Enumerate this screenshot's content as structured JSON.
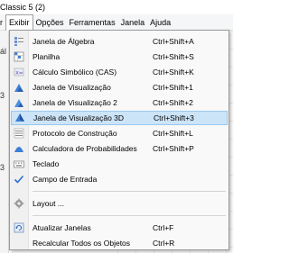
{
  "window": {
    "title": "Classic 5 (2)"
  },
  "menubar": {
    "items": [
      {
        "label": "r",
        "active": false
      },
      {
        "label": "Exibir",
        "active": true
      },
      {
        "label": "Opções",
        "active": false
      },
      {
        "label": "Ferramentas",
        "active": false
      },
      {
        "label": "Janela",
        "active": false
      },
      {
        "label": "Ajuda",
        "active": false
      }
    ]
  },
  "background": {
    "left_labels": [
      "ál",
      "3",
      "3"
    ]
  },
  "menu": {
    "items": [
      {
        "label": "Janela de Álgebra",
        "shortcut": "Ctrl+Shift+A",
        "icon": "algebra-view-icon"
      },
      {
        "label": "Planilha",
        "shortcut": "Ctrl+Shift+S",
        "icon": "spreadsheet-icon"
      },
      {
        "label": "Cálculo Simbólico (CAS)",
        "shortcut": "Ctrl+Shift+K",
        "icon": "cas-icon"
      },
      {
        "label": "Janela de Visualização",
        "shortcut": "Ctrl+Shift+1",
        "icon": "graphics-view-icon"
      },
      {
        "label": "Janela de Visualização 2",
        "shortcut": "Ctrl+Shift+2",
        "icon": "graphics-view-2-icon"
      },
      {
        "label": "Janela de Visualização 3D",
        "shortcut": "Ctrl+Shift+3",
        "icon": "graphics-3d-icon",
        "highlighted": true
      },
      {
        "label": "Protocolo de Construção",
        "shortcut": "Ctrl+Shift+L",
        "icon": "construction-protocol-icon"
      },
      {
        "label": "Calculadora de Probabilidades",
        "shortcut": "Ctrl+Shift+P",
        "icon": "probability-calculator-icon"
      },
      {
        "label": "Teclado",
        "shortcut": "",
        "icon": "keyboard-icon"
      },
      {
        "label": "Campo de Entrada",
        "shortcut": "",
        "icon": "checkmark-icon",
        "checked": true
      },
      {
        "label": "Layout ...",
        "shortcut": "",
        "icon": "layout-gear-icon"
      },
      {
        "label": "Atualizar Janelas",
        "shortcut": "Ctrl+F",
        "icon": "refresh-icon"
      },
      {
        "label": "Recalcular Todos os Objetos",
        "shortcut": "Ctrl+R",
        "icon": ""
      }
    ]
  },
  "colors": {
    "highlight_bg": "#cce4f7",
    "highlight_border": "#99c9ef",
    "toolbar_border": "#3a5fb0"
  }
}
